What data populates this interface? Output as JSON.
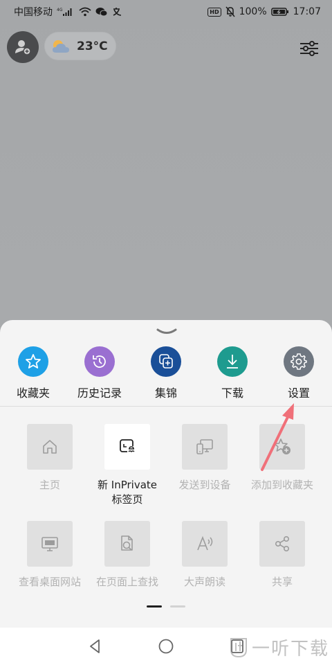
{
  "status_bar": {
    "carrier": "中国移动",
    "network": "4G",
    "hd": "HD",
    "battery": "100%",
    "time": "17:07"
  },
  "header": {
    "temperature": "23°C"
  },
  "quick_actions": [
    {
      "label": "收藏夹",
      "icon": "star-icon",
      "color": "#1ea0e6"
    },
    {
      "label": "历史记录",
      "icon": "history-icon",
      "color": "#9a6fd1"
    },
    {
      "label": "集锦",
      "icon": "collections-icon",
      "color": "#1a4f98"
    },
    {
      "label": "下载",
      "icon": "download-icon",
      "color": "#1e9b8f"
    },
    {
      "label": "设置",
      "icon": "gear-icon",
      "color": "#6f7781"
    }
  ],
  "menu_items": [
    {
      "label": "主页",
      "icon": "home-icon"
    },
    {
      "label": "新 InPrivate\n标签页",
      "label_line1": "新 InPrivate",
      "label_line2": "标签页",
      "icon": "inprivate-tab-icon"
    },
    {
      "label": "发送到设备",
      "icon": "send-to-device-icon"
    },
    {
      "label": "添加到收藏夹",
      "icon": "add-favorite-icon"
    },
    {
      "label": "查看桌面网站",
      "icon": "desktop-site-icon"
    },
    {
      "label": "在页面上查找",
      "icon": "find-in-page-icon"
    },
    {
      "label": "大声朗读",
      "icon": "read-aloud-icon"
    },
    {
      "label": "共享",
      "icon": "share-icon"
    }
  ],
  "pager": {
    "pages": 2,
    "current": 1
  },
  "watermark": {
    "text": "一听下载"
  },
  "colors": {
    "annotation_arrow": "#f07079",
    "sheet_bg": "#f4f4f4",
    "dimmed_bg": "#a8aaac"
  }
}
